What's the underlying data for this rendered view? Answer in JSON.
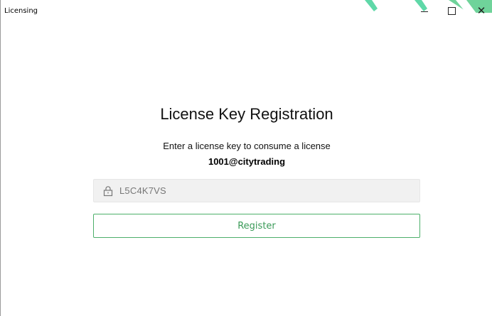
{
  "window": {
    "title": "Licensing",
    "controls": {
      "minimize_icon": "minimize-icon",
      "maximize_icon": "maximize-icon",
      "close_icon": "close-icon",
      "close_glyph": "✕"
    }
  },
  "main": {
    "heading": "License Key Registration",
    "instruction": "Enter a license key to consume a license",
    "account": "1001@citytrading",
    "license_field": {
      "value": "L5C4K7VS",
      "icon": "lock-icon"
    },
    "register_label": "Register"
  },
  "colors": {
    "accent": "#4caf6a",
    "accent_text": "#3a9a58",
    "field_bg": "#f1f1f1"
  }
}
